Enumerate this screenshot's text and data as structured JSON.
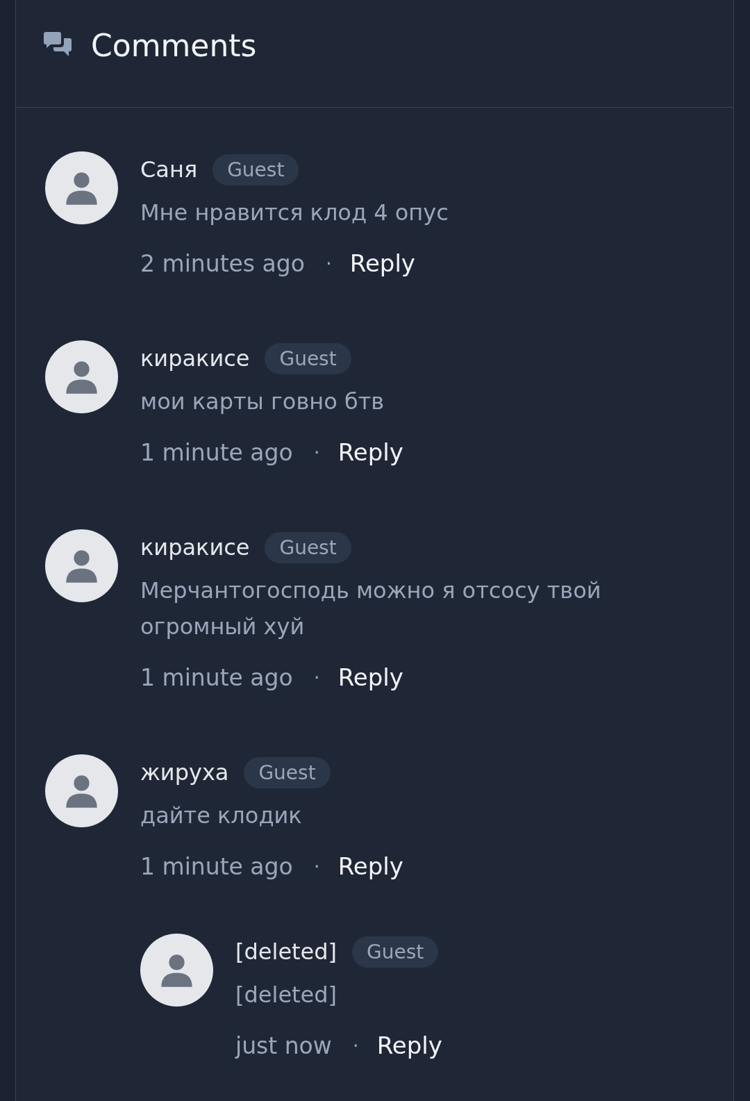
{
  "header": {
    "title": "Comments"
  },
  "comments": [
    {
      "author": "Саня",
      "badge": "Guest",
      "text": "Мне нравится клод 4 опус",
      "time": "2 minutes ago",
      "separator": "·",
      "reply": "Reply"
    },
    {
      "author": "киракисе",
      "badge": "Guest",
      "text": "мои карты говно бтв",
      "time": "1 minute ago",
      "separator": "·",
      "reply": "Reply"
    },
    {
      "author": "киракисе",
      "badge": "Guest",
      "text": "Мерчантогосподь можно я отсосу твой огромный хуй",
      "time": "1 minute ago",
      "separator": "·",
      "reply": "Reply"
    },
    {
      "author": "жируха",
      "badge": "Guest",
      "text": "дайте клодик",
      "time": "1 minute ago",
      "separator": "·",
      "reply": "Reply",
      "children": [
        {
          "author": "[deleted]",
          "badge": "Guest",
          "text": "[deleted]",
          "time": "just now",
          "separator": "·",
          "reply": "Reply"
        }
      ]
    }
  ]
}
